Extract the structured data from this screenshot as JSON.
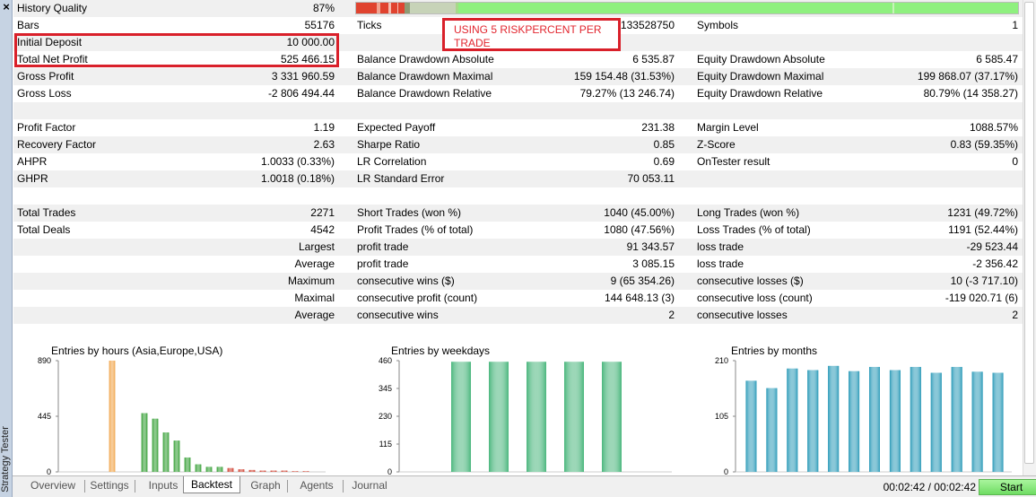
{
  "sidebar": {
    "close_icon": "×",
    "label": "Strategy Tester"
  },
  "note": "USING 5 RISKPERCENT PER TRADE",
  "quality": {
    "segments": [
      {
        "w": 0.031,
        "c": "#e0432f"
      },
      {
        "w": 0.005,
        "c": "#f2a390"
      },
      {
        "w": 0.013,
        "c": "#e0432f"
      },
      {
        "w": 0.004,
        "c": "#f6bcae"
      },
      {
        "w": 0.009,
        "c": "#e0432f"
      },
      {
        "w": 0.002,
        "c": "#f5c0b4"
      },
      {
        "w": 0.009,
        "c": "#e0432f"
      },
      {
        "w": 0.008,
        "c": "#8e9b74"
      },
      {
        "w": 0.07,
        "c": "#c7d3b8"
      },
      {
        "w": 0.004,
        "c": "#a8d88a"
      },
      {
        "w": 0.655,
        "c": "#8ff07f"
      },
      {
        "w": 0.003,
        "c": "#c7f3b9"
      },
      {
        "w": 0.187,
        "c": "#8ff07f"
      }
    ]
  },
  "rows": [
    {
      "alt": true,
      "c1": "History Quality",
      "v1": "87%",
      "c2": "",
      "v2": "",
      "c3": "",
      "v3": "",
      "bar": true
    },
    {
      "alt": false,
      "c1": "Bars",
      "v1": "55176",
      "c2": "Ticks",
      "v2": "133528750",
      "c3": "Symbols",
      "v3": "1"
    },
    {
      "alt": true,
      "c1": "Initial Deposit",
      "v1": "10 000.00",
      "c2": "",
      "v2": "",
      "c3": "",
      "v3": ""
    },
    {
      "alt": false,
      "c1": "Total Net Profit",
      "v1": "525 466.15",
      "c2": "Balance Drawdown Absolute",
      "v2": "6 535.87",
      "c3": "Equity Drawdown Absolute",
      "v3": "6 585.47"
    },
    {
      "alt": true,
      "c1": "Gross Profit",
      "v1": "3 331 960.59",
      "c2": "Balance Drawdown Maximal",
      "v2": "159 154.48 (31.53%)",
      "c3": "Equity Drawdown Maximal",
      "v3": "199 868.07 (37.17%)"
    },
    {
      "alt": false,
      "c1": "Gross Loss",
      "v1": "-2 806 494.44",
      "c2": "Balance Drawdown Relative",
      "v2": "79.27% (13 246.74)",
      "c3": "Equity Drawdown Relative",
      "v3": "80.79% (14 358.27)"
    },
    {
      "alt": true,
      "c1": "",
      "v1": "",
      "c2": "",
      "v2": "",
      "c3": "",
      "v3": ""
    },
    {
      "alt": false,
      "c1": "Profit Factor",
      "v1": "1.19",
      "c2": "Expected Payoff",
      "v2": "231.38",
      "c3": "Margin Level",
      "v3": "1088.57%"
    },
    {
      "alt": true,
      "c1": "Recovery Factor",
      "v1": "2.63",
      "c2": "Sharpe Ratio",
      "v2": "0.85",
      "c3": "Z-Score",
      "v3": "0.83 (59.35%)"
    },
    {
      "alt": false,
      "c1": "AHPR",
      "v1": "1.0033 (0.33%)",
      "c2": "LR Correlation",
      "v2": "0.69",
      "c3": "OnTester result",
      "v3": "0"
    },
    {
      "alt": true,
      "c1": "GHPR",
      "v1": "1.0018 (0.18%)",
      "c2": "LR Standard Error",
      "v2": "70 053.11",
      "c3": "",
      "v3": ""
    },
    {
      "alt": false,
      "c1": "",
      "v1": "",
      "c2": "",
      "v2": "",
      "c3": "",
      "v3": ""
    },
    {
      "alt": true,
      "c1": "Total Trades",
      "v1": "2271",
      "c2": "Short Trades (won %)",
      "v2": "1040 (45.00%)",
      "c3": "Long Trades (won %)",
      "v3": "1231 (49.72%)"
    },
    {
      "alt": false,
      "c1": "Total Deals",
      "v1": "4542",
      "c2": "Profit Trades (% of total)",
      "v2": "1080 (47.56%)",
      "c3": "Loss Trades (% of total)",
      "v3": "1191 (52.44%)"
    },
    {
      "alt": true,
      "c1": "",
      "v1": "Largest",
      "c2": "profit trade",
      "v2": "91 343.57",
      "c3": "loss trade",
      "v3": "-29 523.44"
    },
    {
      "alt": false,
      "c1": "",
      "v1": "Average",
      "c2": "profit trade",
      "v2": "3 085.15",
      "c3": "loss trade",
      "v3": "-2 356.42"
    },
    {
      "alt": true,
      "c1": "",
      "v1": "Maximum",
      "c2": "consecutive wins ($)",
      "v2": "9 (65 354.26)",
      "c3": "consecutive losses ($)",
      "v3": "10 (-3 717.10)"
    },
    {
      "alt": false,
      "c1": "",
      "v1": "Maximal",
      "c2": "consecutive profit (count)",
      "v2": "144 648.13 (3)",
      "c3": "consecutive loss (count)",
      "v3": "-119 020.71 (6)"
    },
    {
      "alt": true,
      "c1": "",
      "v1": "Average",
      "c2": "consecutive wins",
      "v2": "2",
      "c3": "consecutive losses",
      "v3": "2"
    },
    {
      "alt": false,
      "c1": "",
      "v1": "",
      "c2": "",
      "v2": "",
      "c3": "",
      "v3": ""
    }
  ],
  "chart_data": [
    {
      "type": "bar",
      "title": "Entries by hours (Asia,Europe,USA)",
      "ylim": [
        0,
        890
      ],
      "yticks": [
        "890",
        "445",
        "0"
      ],
      "tick_values": [
        890,
        445,
        0
      ],
      "values": [
        0,
        0,
        0,
        0,
        890,
        0,
        0,
        470,
        425,
        315,
        250,
        115,
        60,
        40,
        40,
        30,
        20,
        15,
        10,
        10,
        10,
        5,
        5,
        0
      ],
      "colors": [
        "#d46a26",
        "#d46a26",
        "#d46a26",
        "#d46a26",
        "#f0a040",
        "#d46a26",
        "#d46a26",
        "#2a9a2a",
        "#2a9a2a",
        "#2a9a2a",
        "#2a9a2a",
        "#2a9a2a",
        "#2a9a2a",
        "#2a9a2a",
        "#2a9a2a",
        "#cc3322",
        "#cc3322",
        "#cc3322",
        "#cc3322",
        "#cc3322",
        "#cc3322",
        "#cc3322",
        "#cc3322",
        "#cc3322"
      ]
    },
    {
      "type": "bar",
      "title": "Entries by weekdays",
      "ylim": [
        0,
        460
      ],
      "yticks": [
        "460",
        "345",
        "230",
        "115",
        "0"
      ],
      "tick_values": [
        460,
        345,
        230,
        115,
        0
      ],
      "values": [
        0,
        455,
        455,
        455,
        455,
        455,
        0
      ],
      "colors": [
        "#49b67c",
        "#49b67c",
        "#49b67c",
        "#49b67c",
        "#49b67c",
        "#49b67c",
        "#49b67c"
      ]
    },
    {
      "type": "bar",
      "title": "Entries by months",
      "ylim": [
        0,
        210
      ],
      "yticks": [
        "210",
        "105",
        "0"
      ],
      "tick_values": [
        210,
        105,
        0
      ],
      "values": [
        172,
        158,
        195,
        192,
        200,
        190,
        198,
        192,
        198,
        187,
        198,
        189,
        187
      ],
      "colors": [
        "#2a9ab8",
        "#2a9ab8",
        "#2a9ab8",
        "#2a9ab8",
        "#2a9ab8",
        "#2a9ab8",
        "#2a9ab8",
        "#2a9ab8",
        "#2a9ab8",
        "#2a9ab8",
        "#2a9ab8",
        "#2a9ab8",
        "#2a9ab8"
      ]
    }
  ],
  "tabs": [
    {
      "label": "Overview",
      "active": false
    },
    {
      "label": "Settings",
      "active": false
    },
    {
      "label": "Inputs",
      "active": false
    },
    {
      "label": "Backtest",
      "active": true
    },
    {
      "label": "Graph",
      "active": false
    },
    {
      "label": "Agents",
      "active": false
    },
    {
      "label": "Journal",
      "active": false
    }
  ],
  "timer": "00:02:42 / 00:02:42",
  "start_label": "Start"
}
